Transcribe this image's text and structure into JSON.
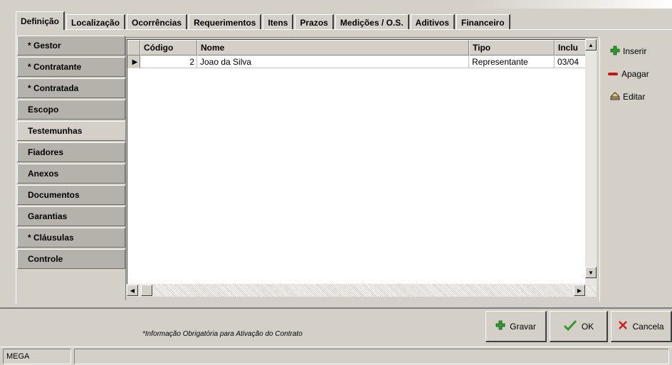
{
  "tabs": [
    {
      "label": "Definição",
      "active": true
    },
    {
      "label": "Localização"
    },
    {
      "label": "Ocorrências"
    },
    {
      "label": "Requerimentos"
    },
    {
      "label": "Itens"
    },
    {
      "label": "Prazos"
    },
    {
      "label": "Medições / O.S."
    },
    {
      "label": "Aditivos"
    },
    {
      "label": "Financeiro"
    }
  ],
  "sidebar": {
    "items": [
      {
        "label": "* Gestor"
      },
      {
        "label": "* Contratante"
      },
      {
        "label": "* Contratada"
      },
      {
        "label": "Escopo"
      },
      {
        "label": "Testemunhas",
        "selected": true
      },
      {
        "label": "Fiadores"
      },
      {
        "label": "Anexos"
      },
      {
        "label": "Documentos"
      },
      {
        "label": "Garantias"
      },
      {
        "label": "* Cláusulas"
      },
      {
        "label": "Controle"
      }
    ]
  },
  "grid": {
    "columns": [
      "Código",
      "Nome",
      "Tipo",
      "Inclu"
    ],
    "rows": [
      {
        "codigo": "2",
        "nome": "Joao da Silva",
        "tipo": "Representante",
        "inclusao": "03/04"
      }
    ]
  },
  "actions": {
    "insert": "Inserir",
    "delete": "Apagar",
    "edit": "Editar"
  },
  "footer": {
    "note": "*Informação Obrigatória para Ativação do Contrato",
    "save": "Gravar",
    "ok": "OK",
    "cancel": "Cancela"
  },
  "status": {
    "app": "MEGA"
  }
}
